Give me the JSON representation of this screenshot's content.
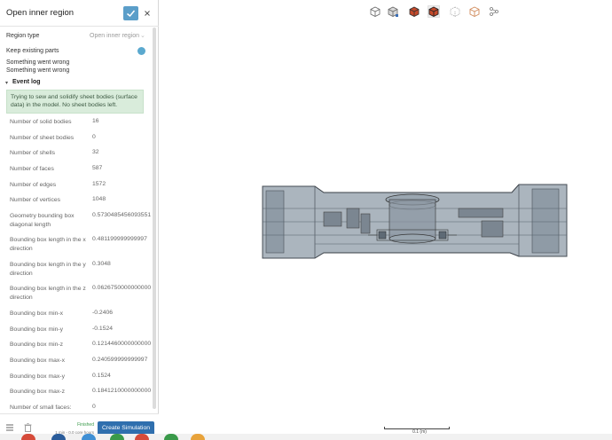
{
  "panel": {
    "title": "Open inner region",
    "region_type_label": "Region type",
    "region_type_value": "Open inner region",
    "keep_existing_parts_label": "Keep existing parts",
    "keep_existing_parts_on": true,
    "errors": [
      "Something went wrong",
      "Something went wrong"
    ],
    "event_log_label": "Event log",
    "info_message": "Trying to sew and solidify sheet bodies (surface data) in the model. No sheet bodies left.",
    "stats": [
      {
        "label": "Number of solid bodies",
        "value": "16"
      },
      {
        "label": "Number of sheet bodies",
        "value": "0"
      },
      {
        "label": "Number of shells",
        "value": "32"
      },
      {
        "label": "Number of faces",
        "value": "587"
      },
      {
        "label": "Number of edges",
        "value": "1572"
      },
      {
        "label": "Number of vertices",
        "value": "1048"
      },
      {
        "label": "Geometry bounding box diagonal length",
        "value": "0.5730485456093551"
      },
      {
        "label": "Bounding box length in the x direction",
        "value": "0.481199999999997"
      },
      {
        "label": "Bounding box length in the y direction",
        "value": "0.3048"
      },
      {
        "label": "Bounding box length in the z direction",
        "value": "0.0626750000000000"
      },
      {
        "label": "Bounding box min-x",
        "value": "-0.2406"
      },
      {
        "label": "Bounding box min-y",
        "value": "-0.1524"
      },
      {
        "label": "Bounding box min-z",
        "value": "0.1214460000000000"
      },
      {
        "label": "Bounding box max-x",
        "value": "0.240599999999997"
      },
      {
        "label": "Bounding box max-y",
        "value": "0.1524"
      },
      {
        "label": "Bounding box max-z",
        "value": "0.1841210000000000"
      },
      {
        "label": "Number of small faces:",
        "value": "0"
      }
    ]
  },
  "footer": {
    "status": "Finished",
    "core_hours": "1 min - 0.0 core hours",
    "create_simulation_label": "Create Simulation"
  },
  "viewer": {
    "toolbar_icons": [
      "cube-outline-icon",
      "cube-shaded-icon",
      "cube-red-icon",
      "cube-red-wire-icon",
      "cube-dotted-icon",
      "cube-orange-icon",
      "settings-nodes-icon"
    ],
    "scale_label": "0.1 (m)"
  },
  "colors": {
    "accent": "#2f6fae",
    "confirm": "#5b9ec9",
    "info_bg": "#d9ecdb",
    "model_fill": "#8c99a4"
  }
}
